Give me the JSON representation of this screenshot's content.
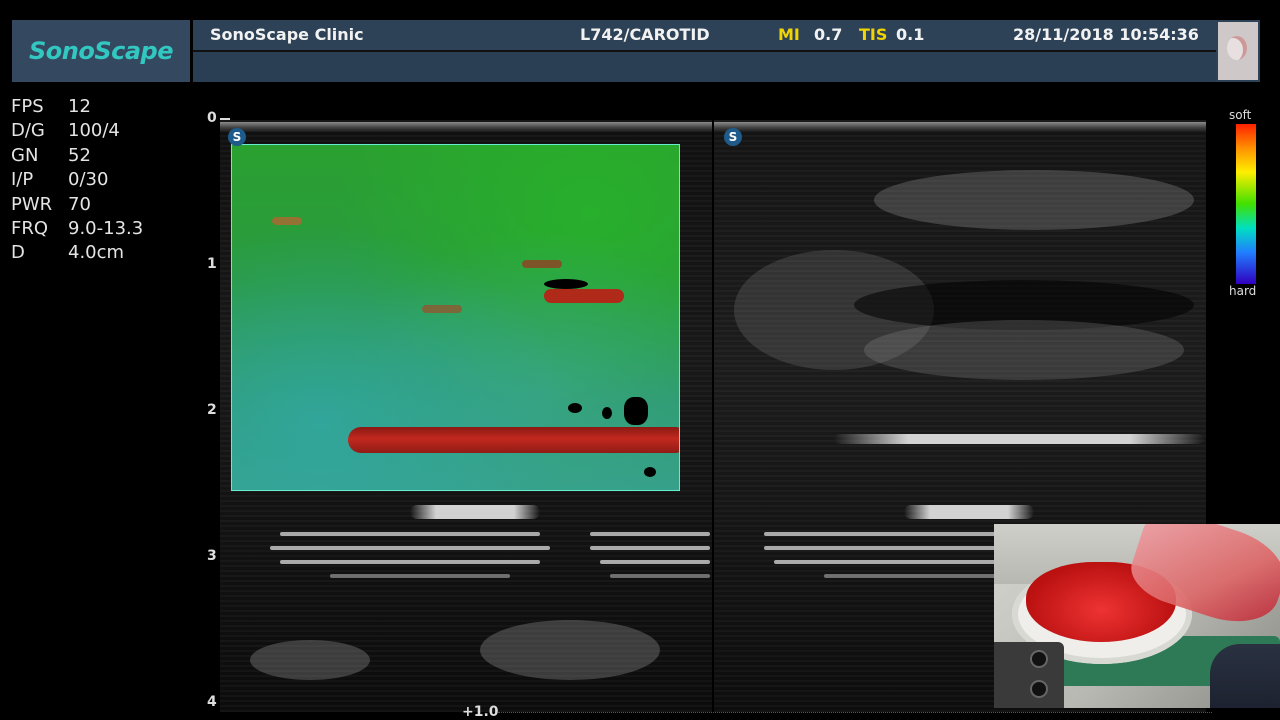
{
  "header": {
    "logo": "SonoScape",
    "clinic": "SonoScape Clinic",
    "probe_preset": "L742/CAROTID",
    "mi_label": "MI",
    "mi_value": "0.7",
    "tis_label": "TIS",
    "tis_value": "0.1",
    "datetime": "28/11/2018 10:54:36"
  },
  "params": [
    {
      "key": "FPS",
      "value": "12"
    },
    {
      "key": "D/G",
      "value": "100/4"
    },
    {
      "key": "GN",
      "value": "52"
    },
    {
      "key": "I/P",
      "value": "0/30"
    },
    {
      "key": "PWR",
      "value": "70"
    },
    {
      "key": "FRQ",
      "value": "9.0-13.3"
    },
    {
      "key": "D",
      "value": "4.0cm"
    }
  ],
  "depth_scale": {
    "labels": [
      "0",
      "1",
      "2",
      "3",
      "4"
    ]
  },
  "image_marker": "S",
  "colorbar": {
    "top_label": "soft",
    "bottom_label": "hard",
    "colors": [
      "#ff2000",
      "#ffee00",
      "#40e000",
      "#00e0c0",
      "#3000c0"
    ]
  },
  "bottom_indicator": "+1.0"
}
